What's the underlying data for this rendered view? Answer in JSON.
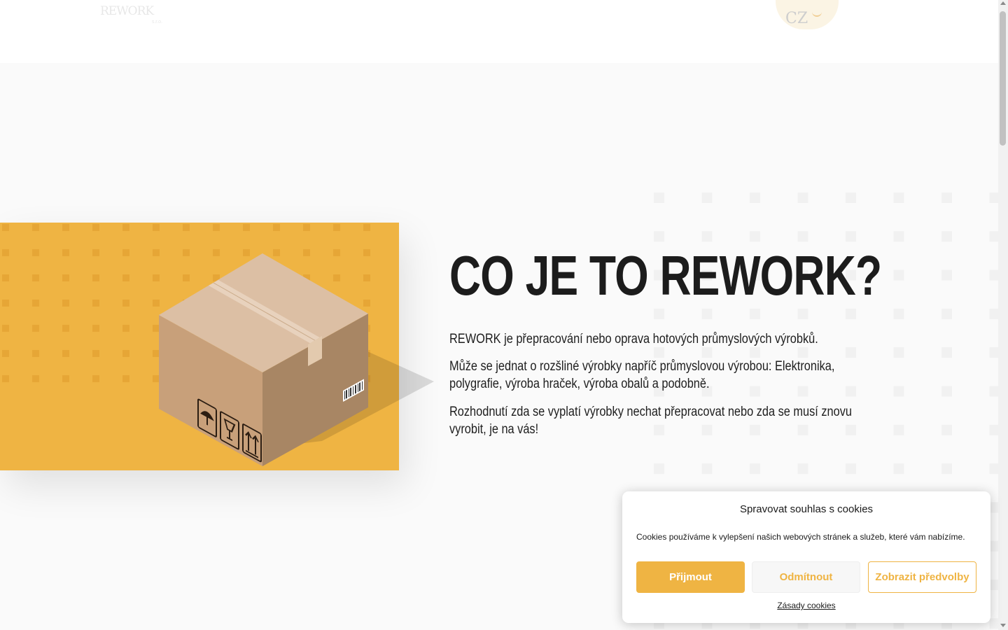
{
  "header": {
    "logo_text": "REWORK",
    "logo_sub": "s.r.o.",
    "badge_text": "CZ"
  },
  "hero": {
    "title": "CO JE TO REWORK?",
    "paragraphs": [
      "REWORK je přepracování nebo oprava hotových průmyslových výrobků.",
      "Může se jednat o rozšliné výrobky napříč průmyslovou výrobou: Elektronika, polygrafie, výroba hraček, výroba obalů a podobně.",
      "Rozhodnutí zda se vyplatí výrobky nechat přepracovat nebo zda se musí znovu vyrobit, je na vás!"
    ]
  },
  "cookie": {
    "title": "Spravovat souhlas s cookies",
    "text": "Cookies používáme k vylepšení našich webových stránek a služeb, které vám nabízíme.",
    "accept_label": "Přijmout",
    "deny_label": "Odmítnout",
    "prefs_label": "Zobrazit předvolby",
    "policy_link": "Zásady cookies"
  },
  "colors": {
    "accent": "#efb443",
    "background": "#fafafa",
    "text": "#1c1c1c"
  }
}
